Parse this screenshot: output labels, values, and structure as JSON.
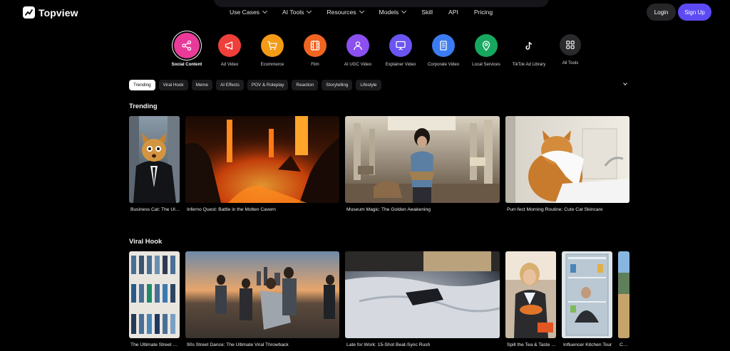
{
  "brand": {
    "name": "Topview"
  },
  "nav": [
    {
      "label": "Use Cases",
      "dropdown": true
    },
    {
      "label": "AI Tools",
      "dropdown": true
    },
    {
      "label": "Resources",
      "dropdown": true
    },
    {
      "label": "Models",
      "dropdown": true
    },
    {
      "label": "Skill",
      "dropdown": false
    },
    {
      "label": "API",
      "dropdown": false
    },
    {
      "label": "Pricing",
      "dropdown": false
    }
  ],
  "auth": {
    "login": "Login",
    "signup": "Sign Up"
  },
  "categories": [
    {
      "label": "Social Content",
      "icon": "share-icon",
      "color": "#e93a9a",
      "active": true
    },
    {
      "label": "Ad Video",
      "icon": "megaphone-icon",
      "color": "#ef3f3a"
    },
    {
      "label": "Ecommerce",
      "icon": "cart-icon",
      "color": "#f39b16"
    },
    {
      "label": "Film",
      "icon": "film-icon",
      "color": "#f26422"
    },
    {
      "label": "AI UGC Video",
      "icon": "user-icon",
      "color": "#8c4ff0"
    },
    {
      "label": "Explainer Video",
      "icon": "presentation-icon",
      "color": "#6a55f2"
    },
    {
      "label": "Corporate Video",
      "icon": "building-icon",
      "color": "#3c7cf2"
    },
    {
      "label": "Local Services",
      "icon": "map-pin-icon",
      "color": "#17a860"
    },
    {
      "label": "TikTok Ad Library",
      "icon": "tiktok-icon",
      "color": "#000000"
    },
    {
      "label": "All Tools",
      "icon": "grid-icon",
      "color": "#2a2a2c"
    }
  ],
  "tags": [
    "Trending",
    "Viral Hook",
    "Meme",
    "AI Effects",
    "POV & Roleplay",
    "Reaction",
    "Storytelling",
    "Lifestyle"
  ],
  "sections": [
    {
      "title": "Trending",
      "cards": [
        {
          "title": "Business Cat: The Ultimate Boss"
        },
        {
          "title": "Inferno Quest: Battle in the Molten Cavern"
        },
        {
          "title": "Museum Magic: The Golden Awakening"
        },
        {
          "title": "Purr-fect Morning Routine: Cute Cat Skincare"
        }
      ]
    },
    {
      "title": "Viral Hook",
      "cards": [
        {
          "title": "The Ultimate Street Style"
        },
        {
          "title": "90s Street Dance: The Ultimate Viral Throwback"
        },
        {
          "title": "Late for Work: 15-Shot Beat-Sync Rush"
        },
        {
          "title": "Spill the Tea & Taste Test"
        },
        {
          "title": "Influencer Kitchen Tour"
        },
        {
          "title": "Collection"
        }
      ]
    }
  ]
}
